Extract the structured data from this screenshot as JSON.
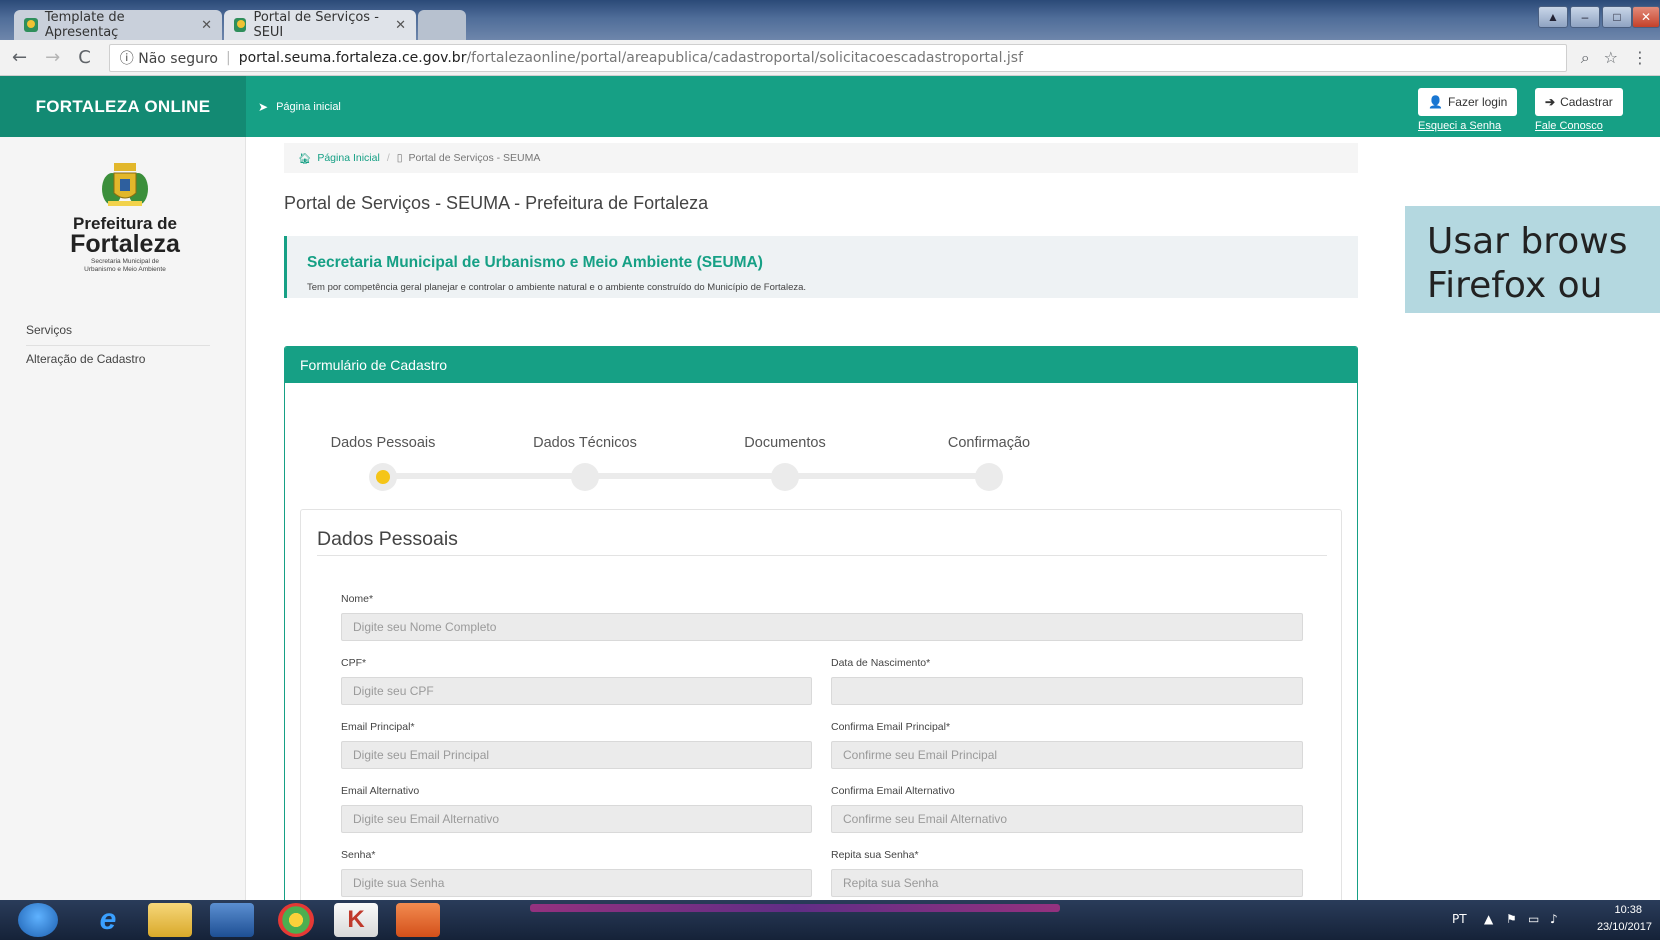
{
  "browser": {
    "tabs": [
      {
        "title": "Template de Apresentaç",
        "active": false
      },
      {
        "title": "Portal de Serviços - SEUI",
        "active": true
      }
    ],
    "secure_label": "ⓘ Não seguro",
    "url_host": "portal.seuma.fortaleza.ce.gov.br",
    "url_path": "/fortalezaonline/portal/areapublica/cadastroportal/solicitacoescadastroportal.jsf"
  },
  "header": {
    "brand": "FORTALEZA ONLINE",
    "nav_home": "Página inicial",
    "login_button": "Fazer login",
    "register_button": "Cadastrar",
    "forgot_link": "Esqueci a Senha",
    "contact_link": "Fale Conosco"
  },
  "sidebar": {
    "logo_line1": "Prefeitura de",
    "logo_line2": "Fortaleza",
    "logo_sub1": "Secretaria Municipal de",
    "logo_sub2": "Urbanismo e Meio Ambiente",
    "items": [
      {
        "label": "Serviços"
      },
      {
        "label": "Alteração de Cadastro"
      }
    ]
  },
  "breadcrumb": {
    "home": "Página Inicial",
    "current": "Portal de Serviços - SEUMA"
  },
  "page_title": "Portal de Serviços - SEUMA - Prefeitura de Fortaleza",
  "info": {
    "title": "Secretaria Municipal de Urbanismo e Meio Ambiente (SEUMA)",
    "text": "Tem por competência geral planejar e controlar o ambiente natural e o ambiente construído do Município de Fortaleza."
  },
  "form": {
    "header": "Formulário de Cadastro",
    "steps": [
      {
        "label": "Dados Pessoais",
        "active": true
      },
      {
        "label": "Dados Técnicos",
        "active": false
      },
      {
        "label": "Documentos",
        "active": false
      },
      {
        "label": "Confirmação",
        "active": false
      }
    ],
    "section_title": "Dados Pessoais",
    "fields": {
      "nome": {
        "label": "Nome*",
        "placeholder": "Digite seu Nome Completo",
        "value": ""
      },
      "cpf": {
        "label": "CPF*",
        "placeholder": "Digite seu CPF",
        "value": ""
      },
      "nascimento": {
        "label": "Data de Nascimento*",
        "placeholder": "",
        "value": ""
      },
      "email": {
        "label": "Email Principal*",
        "placeholder": "Digite seu Email Principal",
        "value": ""
      },
      "email_confirm": {
        "label": "Confirma Email Principal*",
        "placeholder": "Confirme seu Email Principal",
        "value": ""
      },
      "email_alt": {
        "label": "Email Alternativo",
        "placeholder": "Digite seu Email Alternativo",
        "value": ""
      },
      "email_alt_confirm": {
        "label": "Confirma Email Alternativo",
        "placeholder": "Confirme seu Email Alternativo",
        "value": ""
      },
      "senha": {
        "label": "Senha*",
        "placeholder": "Digite sua Senha",
        "value": ""
      },
      "senha_confirm": {
        "label": "Repita sua Senha*",
        "placeholder": "Repita sua Senha",
        "value": ""
      }
    }
  },
  "overlay_note": {
    "line1": "Usar brows",
    "line2": "Firefox ou"
  },
  "taskbar": {
    "language": "PT",
    "time": "10:38",
    "date": "23/10/2017"
  },
  "colors": {
    "brand_green": "#16a085",
    "brand_dark": "#138a73",
    "step_active": "#f5c518",
    "note_bg": "#b4d8e0"
  },
  "icons": {
    "home": "home-icon",
    "page": "page-icon",
    "login": "user-icon",
    "register": "arrow-right-icon",
    "pin": "pin-icon"
  }
}
